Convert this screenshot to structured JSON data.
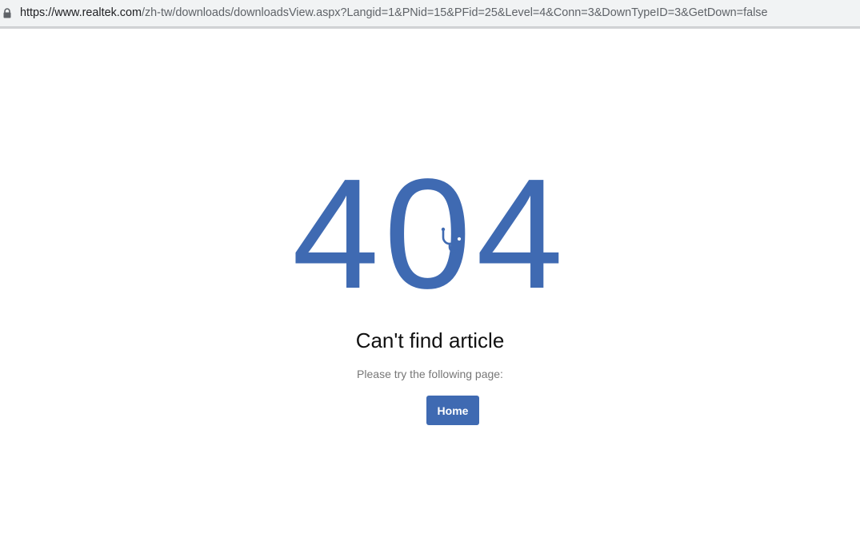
{
  "browser": {
    "url_host": "https://www.realtek.com",
    "url_path": "/zh-tw/downloads/downloadsView.aspx?Langid=1&PNid=15&PFid=25&Level=4&Conn=3&DownTypeID=3&GetDown=false",
    "lock_icon": "lock-icon"
  },
  "error": {
    "digit1": "4",
    "digit2": "0",
    "digit3": "4",
    "icon": "stethoscope-icon",
    "title": "Can't find article",
    "subtitle": "Please try the following page:",
    "home_label": "Home"
  },
  "colors": {
    "accent": "#3f6ab2",
    "title": "#111111",
    "subtitle": "#777777",
    "address_bar_bg": "#f1f3f4"
  }
}
